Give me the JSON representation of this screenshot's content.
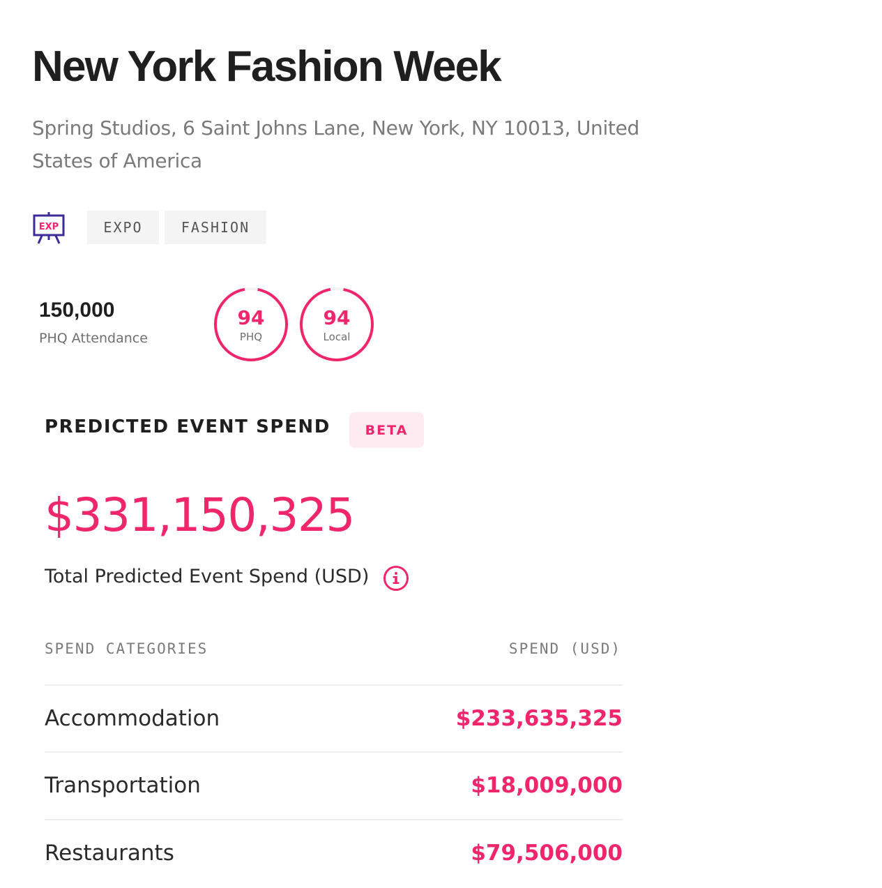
{
  "event": {
    "title": "New York Fashion Week",
    "address": "Spring Studios, 6 Saint Johns Lane, New York, NY 10013, United States of America",
    "category_icon": "expo-easel-icon",
    "category_icon_text": "EXP",
    "labels": [
      "EXPO",
      "FASHION"
    ]
  },
  "stats": {
    "attendance_value": "150,000",
    "attendance_label": "PHQ Attendance",
    "ranks": [
      {
        "value": "94",
        "label": "PHQ",
        "fraction": 0.94
      },
      {
        "value": "94",
        "label": "Local",
        "fraction": 0.94
      }
    ]
  },
  "spend": {
    "section_title": "PREDICTED EVENT SPEND",
    "badge": "BETA",
    "total_amount": "$331,150,325",
    "total_label": "Total Predicted Event Spend (USD)",
    "info_icon": "info-icon",
    "table": {
      "headers": [
        "SPEND CATEGORIES",
        "SPEND (USD)"
      ],
      "rows": [
        {
          "category": "Accommodation",
          "amount": "$233,635,325"
        },
        {
          "category": "Transportation",
          "amount": "$18,009,000"
        },
        {
          "category": "Restaurants",
          "amount": "$79,506,000"
        }
      ]
    }
  },
  "colors": {
    "accent": "#f0266b",
    "accent_light": "#fdebf1",
    "icon_purple": "#3b2a99",
    "tag_bg": "#f4f4f4",
    "ring_track": "#f3f3f3"
  }
}
